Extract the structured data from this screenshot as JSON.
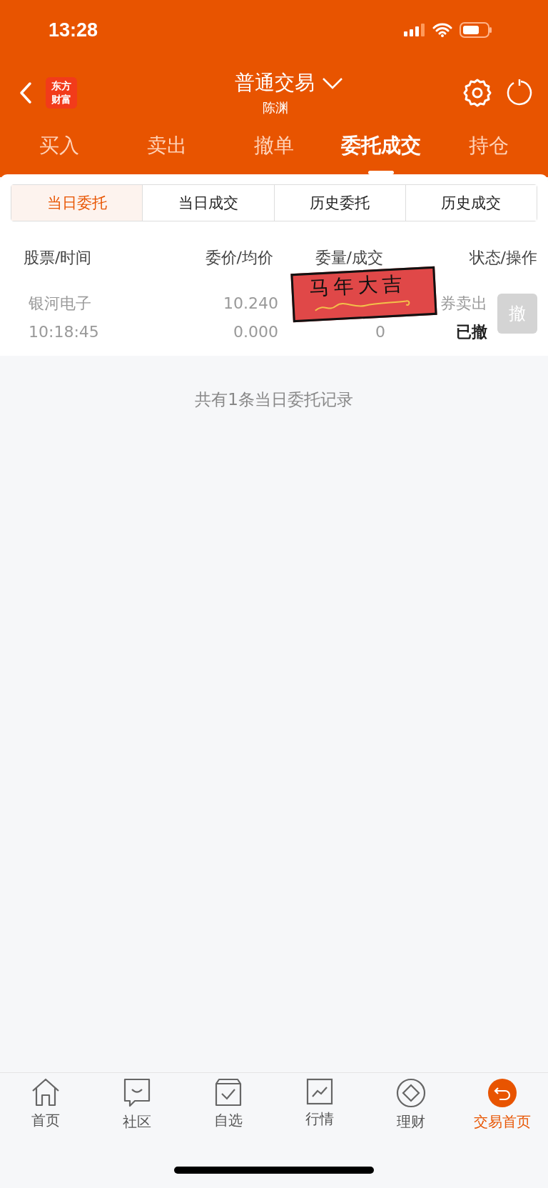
{
  "status_bar": {
    "time": "13:28"
  },
  "header": {
    "logo": "东方财富",
    "title": "普通交易",
    "subtitle": "陈渊"
  },
  "tabs": [
    {
      "label": "买入",
      "selected": false
    },
    {
      "label": "卖出",
      "selected": false
    },
    {
      "label": "撤单",
      "selected": false
    },
    {
      "label": "委托成交",
      "selected": true
    },
    {
      "label": "持仓",
      "selected": false
    }
  ],
  "segments": [
    {
      "label": "当日委托",
      "selected": true
    },
    {
      "label": "当日成交",
      "selected": false
    },
    {
      "label": "历史委托",
      "selected": false
    },
    {
      "label": "历史成交",
      "selected": false
    }
  ],
  "table": {
    "columns": [
      "股票/时间",
      "委价/均价",
      "委量/成交",
      "状态/操作"
    ],
    "rows": [
      {
        "name": "银河电子",
        "time": "10:18:45",
        "price": "10.240",
        "avg_price": "0.000",
        "filled": "0",
        "type": "券卖出",
        "status": "已撤",
        "action": "撤",
        "action_disabled": true
      }
    ]
  },
  "sticker": {
    "text": "马年大吉"
  },
  "footer_note": "共有1条当日委托记录",
  "bottom_nav": [
    {
      "label": "首页",
      "kind": "home",
      "selected": false
    },
    {
      "label": "社区",
      "kind": "community",
      "selected": false
    },
    {
      "label": "自选",
      "kind": "watchlist",
      "selected": false
    },
    {
      "label": "行情",
      "kind": "market",
      "selected": false
    },
    {
      "label": "理财",
      "kind": "wealth",
      "selected": false
    },
    {
      "label": "交易首页",
      "kind": "trade",
      "selected": true
    }
  ]
}
